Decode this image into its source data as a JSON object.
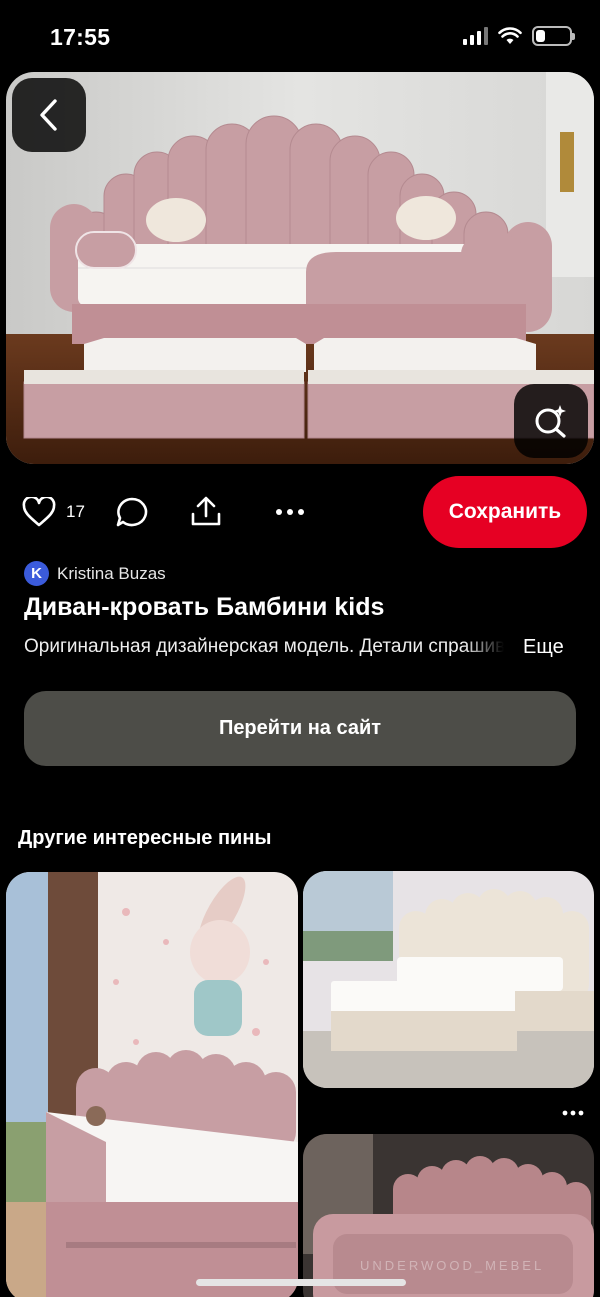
{
  "status_bar": {
    "time": "17:55"
  },
  "pin": {
    "like_count": "17",
    "save_label": "Сохранить",
    "author": {
      "initial": "K",
      "name": "Kristina Buzas"
    },
    "title": "Диван-кровать Бамбини kids",
    "description": "Оригинальная дизайнерская модель. Детали спрашивайте у менеджера",
    "more_label": "Еще",
    "visit_label": "Перейти на сайт"
  },
  "related": {
    "section_title": "Другие интересные пины",
    "watermark": "UNDERWOOD_MEBEL"
  },
  "colors": {
    "save": "#e60023",
    "visit_button": "#4d4d48",
    "bed_pink": "#c79ea3"
  },
  "icons": [
    "chevron-left-icon",
    "visual-search-icon",
    "heart-icon",
    "comment-icon",
    "share-icon",
    "more-icon"
  ]
}
